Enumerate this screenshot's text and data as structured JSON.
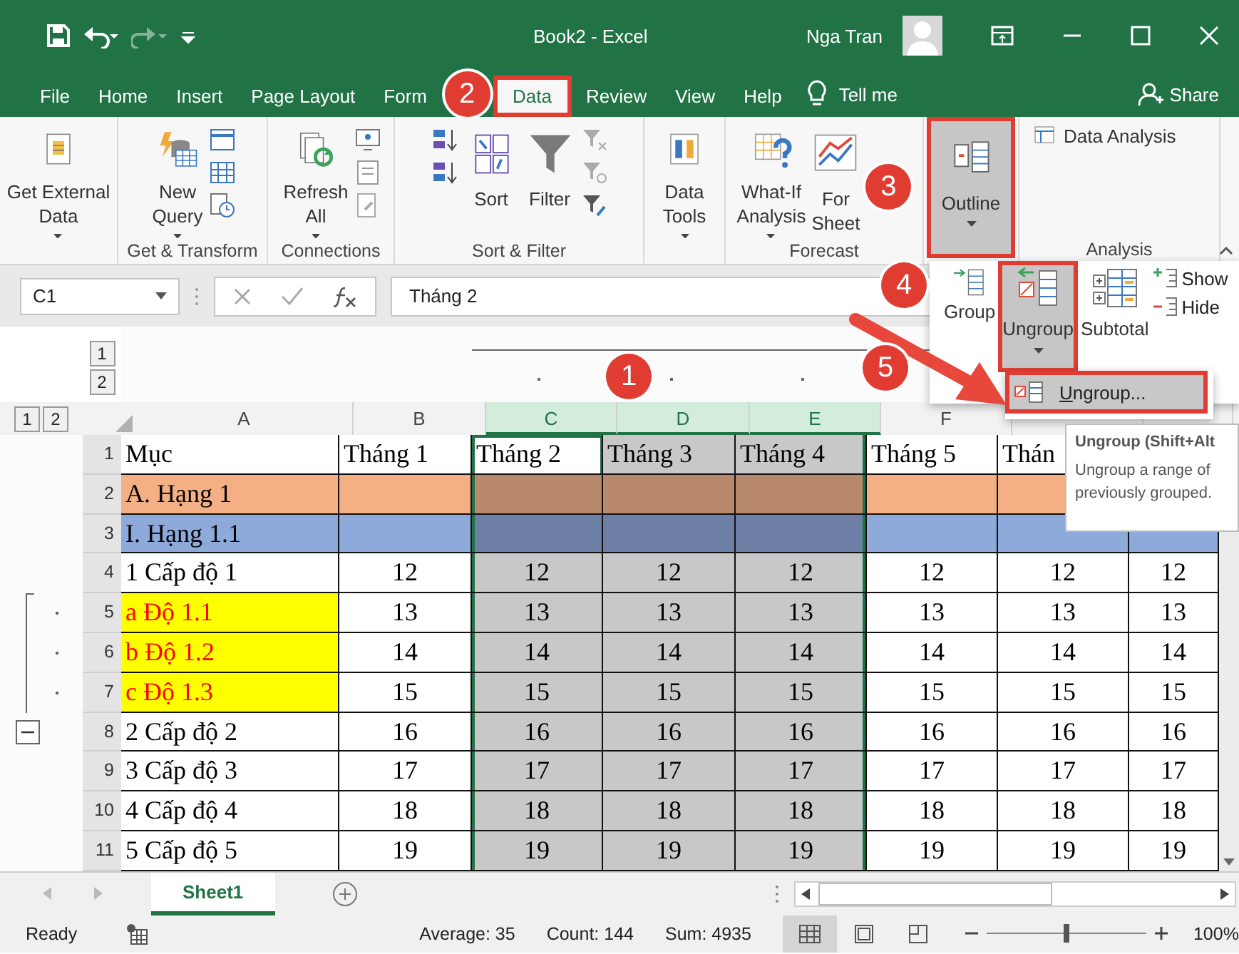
{
  "title_bar": {
    "title": "Book2  -  Excel",
    "user": "Nga Tran"
  },
  "tabs": [
    {
      "label": "File",
      "selected": false,
      "marked": false
    },
    {
      "label": "Home",
      "selected": false,
      "marked": false
    },
    {
      "label": "Insert",
      "selected": false,
      "marked": false
    },
    {
      "label": "Page Layout",
      "selected": false,
      "marked": false
    },
    {
      "label": "Form",
      "selected": false,
      "marked": false
    },
    {
      "label": "Data",
      "selected": true,
      "marked": true
    },
    {
      "label": "Review",
      "selected": false,
      "marked": false
    },
    {
      "label": "View",
      "selected": false,
      "marked": false
    },
    {
      "label": "Help",
      "selected": false,
      "marked": false
    }
  ],
  "tell_me": "Tell me",
  "share": "Share",
  "ribbon": {
    "groups": [
      {
        "buttons": [
          {
            "lines": [
              "Get External",
              "Data"
            ],
            "dropdown": true,
            "pressed": false,
            "marked": false
          }
        ]
      },
      {
        "label": "Get & Transform",
        "buttons": [
          {
            "lines": [
              "New",
              "Query"
            ],
            "dropdown": true,
            "pressed": false,
            "marked": false
          }
        ]
      },
      {
        "label": "Connections",
        "buttons": [
          {
            "lines": [
              "Refresh",
              "All"
            ],
            "dropdown": true,
            "pressed": false,
            "marked": false
          }
        ]
      },
      {
        "label": "Sort & Filter",
        "buttons": [
          {
            "lines": [
              "Sort"
            ],
            "pressed": false,
            "marked": false
          },
          {
            "lines": [
              "Filter"
            ],
            "pressed": false,
            "marked": false
          }
        ]
      },
      {
        "buttons": [
          {
            "lines": [
              "Data",
              "Tools"
            ],
            "dropdown": true,
            "pressed": false,
            "marked": false
          }
        ]
      },
      {
        "label": "Forecast",
        "buttons": [
          {
            "lines": [
              "What-If",
              "Analysis"
            ],
            "dropdown": true,
            "pressed": false,
            "marked": false
          },
          {
            "lines": [
              "For",
              "Sheet"
            ],
            "pressed": false,
            "marked": false
          }
        ]
      },
      {
        "buttons": [
          {
            "lines": [
              "Outline"
            ],
            "dropdown": true,
            "pressed": true,
            "marked": true
          }
        ]
      },
      {
        "label": "Analysis",
        "buttons": [
          {
            "lines": [
              "Data Analysis"
            ],
            "pressed": false,
            "marked": false
          }
        ]
      }
    ]
  },
  "formula_bar": {
    "name_box": "C1",
    "formula": "Tháng 2"
  },
  "outline_levels": {
    "columns": [
      "1",
      "2"
    ],
    "rows": [
      "1",
      "2"
    ]
  },
  "columns": [
    {
      "label": "A",
      "selected": false,
      "active": false,
      "grouped": false
    },
    {
      "label": "B",
      "selected": false,
      "active": false,
      "grouped": false
    },
    {
      "label": "C",
      "selected": true,
      "active": true,
      "grouped": true
    },
    {
      "label": "D",
      "selected": true,
      "active": false,
      "grouped": true
    },
    {
      "label": "E",
      "selected": true,
      "active": false,
      "grouped": true
    },
    {
      "label": "F",
      "selected": false,
      "active": false
    }
  ],
  "row_group": {
    "expanded": true
  },
  "rows": [
    {
      "number": "1",
      "kind": "header",
      "grouped": false,
      "cells": [
        "Mục",
        "Tháng 1",
        "Tháng 2",
        "Tháng 3",
        "Tháng 4",
        "Tháng 5",
        "Thán"
      ]
    },
    {
      "number": "2",
      "kind": "section",
      "grouped": false,
      "cells": [
        "A. Hạng 1"
      ]
    },
    {
      "number": "3",
      "kind": "subsection",
      "grouped": false,
      "cells": [
        "I. Hạng 1.1"
      ]
    },
    {
      "number": "4",
      "kind": "item",
      "grouped": false,
      "cells": [
        "1 Cấp độ 1",
        "12",
        "12",
        "12",
        "12",
        "12",
        "12",
        "12"
      ]
    },
    {
      "number": "5",
      "kind": "subitem",
      "grouped": true,
      "cells": [
        "a Độ 1.1",
        "13",
        "13",
        "13",
        "13",
        "13",
        "13",
        "13"
      ]
    },
    {
      "number": "6",
      "kind": "subitem",
      "grouped": true,
      "cells": [
        "b Độ 1.2",
        "14",
        "14",
        "14",
        "14",
        "14",
        "14",
        "14"
      ]
    },
    {
      "number": "7",
      "kind": "subitem",
      "grouped": true,
      "cells": [
        "c Độ 1.3",
        "15",
        "15",
        "15",
        "15",
        "15",
        "15",
        "15"
      ]
    },
    {
      "number": "8",
      "kind": "item",
      "grouped": false,
      "cells": [
        "2 Cấp độ 2",
        "16",
        "16",
        "16",
        "16",
        "16",
        "16",
        "16"
      ]
    },
    {
      "number": "9",
      "kind": "item",
      "grouped": false,
      "cells": [
        "3 Cấp độ 3",
        "17",
        "17",
        "17",
        "17",
        "17",
        "17",
        "17"
      ]
    },
    {
      "number": "10",
      "kind": "item",
      "grouped": false,
      "cells": [
        "4 Cấp độ 4",
        "18",
        "18",
        "18",
        "18",
        "18",
        "18",
        "18"
      ]
    },
    {
      "number": "11",
      "kind": "item",
      "grouped": false,
      "cells": [
        "5 Cấp độ 5",
        "19",
        "19",
        "19",
        "19",
        "19",
        "19",
        "19"
      ]
    }
  ],
  "sheets": [
    {
      "label": "Sheet1",
      "selected": true
    }
  ],
  "status_bar": {
    "mode": "Ready",
    "average": "Average: 35",
    "count": "Count: 144",
    "sum": "Sum: 4935",
    "views": [
      {
        "selected": true
      },
      {
        "selected": false
      },
      {
        "selected": false
      }
    ],
    "zoom": {
      "level": 0.5,
      "label": "100%"
    }
  },
  "outline_menu": {
    "buttons": [
      {
        "label": "Group",
        "selected": false,
        "marked": false
      },
      {
        "label": "Ungroup",
        "selected": true,
        "marked": true,
        "dropdown": true
      },
      {
        "label": "Subtotal",
        "selected": false,
        "marked": false
      }
    ],
    "side_items": [
      {
        "kind": "show",
        "label": "Show"
      },
      {
        "kind": "hide",
        "label": "Hide"
      }
    ],
    "submenu": [
      {
        "label": "Ungroup...",
        "selected": true,
        "marked": true
      }
    ]
  },
  "tooltip": {
    "title": "Ungroup (Shift+Alt",
    "text": "Ungroup a range of previously grouped."
  },
  "callouts": [
    "1",
    "2",
    "3",
    "4",
    "5"
  ]
}
